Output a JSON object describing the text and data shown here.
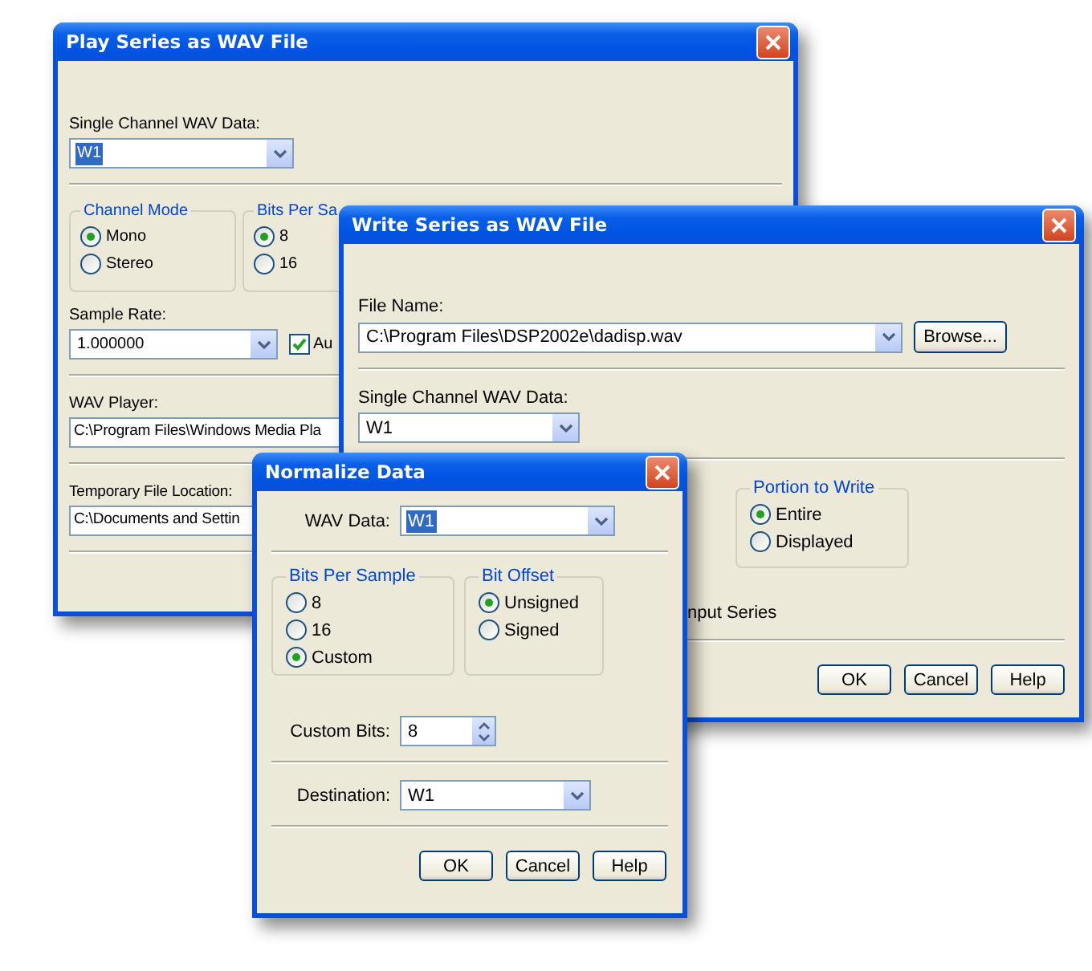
{
  "play_dialog": {
    "title": "Play Series as WAV File",
    "data_label": "Single Channel WAV Data:",
    "data_combo": {
      "value": "W1",
      "highlighted": true
    },
    "groups": [
      {
        "title": "Channel Mode",
        "options": [
          {
            "label": "Mono",
            "selected": true
          },
          {
            "label": "Stereo",
            "selected": false
          }
        ]
      },
      {
        "title": "Bits Per Sa",
        "options": [
          {
            "label": "8",
            "selected": true
          },
          {
            "label": "16",
            "selected": false
          }
        ]
      }
    ],
    "sample_rate_label": "Sample Rate:",
    "sample_rate": {
      "value": "1.000000",
      "highlighted": false
    },
    "auto_checkbox": {
      "label": "Au",
      "checked": true
    },
    "player_label": "WAV Player:",
    "player_path": "C:\\Program Files\\Windows Media Pla",
    "temp_label": "Temporary File Location:",
    "temp_path": "C:\\Documents and Settin"
  },
  "write_dialog": {
    "title": "Write Series as WAV File",
    "file_label": "File Name:",
    "file_combo": {
      "value": "C:\\Program Files\\DSP2002e\\dadisp.wav",
      "highlighted": false
    },
    "browse_button": "Browse...",
    "data_label": "Single Channel WAV Data:",
    "data_combo": {
      "value": "W1",
      "highlighted": false
    },
    "portion_group": {
      "title": "Portion to Write",
      "options": [
        {
          "label": "Entire",
          "selected": true
        },
        {
          "label": "Displayed",
          "selected": false
        }
      ]
    },
    "input_series_label": "nput Series",
    "buttons": [
      "OK",
      "Cancel",
      "Help"
    ]
  },
  "normalize_dialog": {
    "title": "Normalize Data",
    "wav_data_label": "WAV Data:",
    "wav_data": {
      "value": "W1",
      "highlighted": true
    },
    "groups": [
      {
        "title": "Bits Per Sample",
        "options": [
          {
            "label": "8",
            "selected": false
          },
          {
            "label": "16",
            "selected": false
          },
          {
            "label": "Custom",
            "selected": true
          }
        ]
      },
      {
        "title": "Bit Offset",
        "options": [
          {
            "label": "Unsigned",
            "selected": true
          },
          {
            "label": "Signed",
            "selected": false
          }
        ]
      }
    ],
    "custom_bits_label": "Custom Bits:",
    "custom_bits": "8",
    "destination_label": "Destination:",
    "destination": {
      "value": "W1",
      "highlighted": false
    },
    "buttons": [
      "OK",
      "Cancel",
      "Help"
    ]
  }
}
